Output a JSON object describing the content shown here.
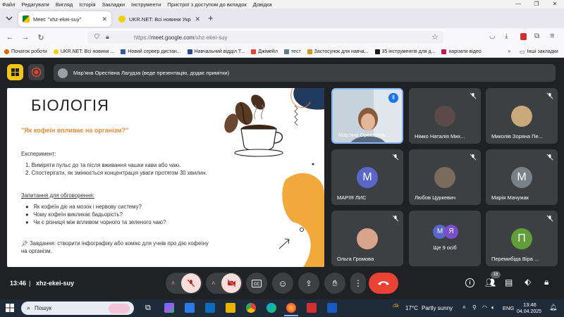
{
  "menubar": {
    "items": [
      "Файл",
      "Редагувати",
      "Вигляд",
      "Історія",
      "Закладки",
      "Інструменти",
      "Пристрої з доступом до вкладок",
      "Довідка"
    ]
  },
  "tabs": [
    {
      "title": "Meet: \"xhz-ekei-suy\"",
      "active": true
    },
    {
      "title": "UKR.NET: Всі новини України,",
      "active": false
    }
  ],
  "url": {
    "scheme": "https://",
    "host": "meet.google.com",
    "path": "/xhz-ekei-suy"
  },
  "bookmarks": [
    "Початок роботи",
    "UKR.NET: Всі новини ...",
    "Новий сервер дистан...",
    "Навчальний відділ Т...",
    "Джімейл",
    "тест",
    "Застосунок для навча...",
    "35 інструментів для д...",
    "нарізати відео"
  ],
  "bookmarks_other": "Інші закладки",
  "presenter_bar": "Мар'яна Орестівна Лагудза (веде презентацію, додає примітки)",
  "slide": {
    "title": "БІОЛОГІЯ",
    "question": "\"Як кофеїн впливає на організм?\"",
    "experiment_heading": "Експеримент:",
    "experiment_items": [
      "1.  Виміряти пульс до та після вживання чашки кави або чаю.",
      "2.  Спостерігати, як змінюється концентрація уваги протягом 30 хвилин."
    ],
    "discussion_heading": "Запитання для обговорення:",
    "discussion_items": [
      "Як кофеїн діє на мозок і нервову систему?",
      "Чому кофеїн викликає бадьорість?",
      "Чи є різниця між впливом чорного та зеленого чаю?"
    ],
    "task_line1": "Завдання: створити інфографіку або комікс для учнів про дію кофеїну",
    "task_line2": "на організм."
  },
  "participants": [
    {
      "name": "Мар'яна Орестівна...",
      "initial": "",
      "color": "#6d8fb5",
      "speaking": true
    },
    {
      "name": "Німко Наталія Мих...",
      "initial": "",
      "color": "#5c4a48",
      "speaking": false
    },
    {
      "name": "Миколів Зоряна Пе...",
      "initial": "",
      "color": "#c9a87a",
      "speaking": false
    },
    {
      "name": "МАРІЯ ЛИС",
      "initial": "М",
      "color": "#5b66c9",
      "speaking": false
    },
    {
      "name": "Любов Цуркевич",
      "initial": "",
      "color": "#7a6b5d",
      "speaking": false
    },
    {
      "name": "Марія Мачужак",
      "initial": "М",
      "color": "#78828a",
      "speaking": false
    },
    {
      "name": "Ольга Громова",
      "initial": "",
      "color": "#d9a48c",
      "speaking": false
    },
    {
      "name": "Ще 9 осіб",
      "initial": "",
      "color": "",
      "speaking": false
    },
    {
      "name": "Перемибіда Віра ...",
      "initial": "П",
      "color": "#5f9e3a",
      "speaking": false
    }
  ],
  "more_avatars": [
    "М",
    "Я"
  ],
  "meeting": {
    "time": "13:46",
    "code": "xhz-ekei-suy",
    "people_count": "18"
  },
  "taskbar": {
    "search": "Пошук",
    "weather_temp": "17°C",
    "weather_text": "Partly sunny",
    "lang": "ENG",
    "clock_time": "13:46",
    "clock_date": "04.04.2025"
  },
  "colors": {
    "meet_bg": "#202124",
    "tile_bg": "#3c4043",
    "end_call": "#ea4335",
    "muted": "#f9dedc",
    "accent_blue": "#8ab4f8"
  }
}
